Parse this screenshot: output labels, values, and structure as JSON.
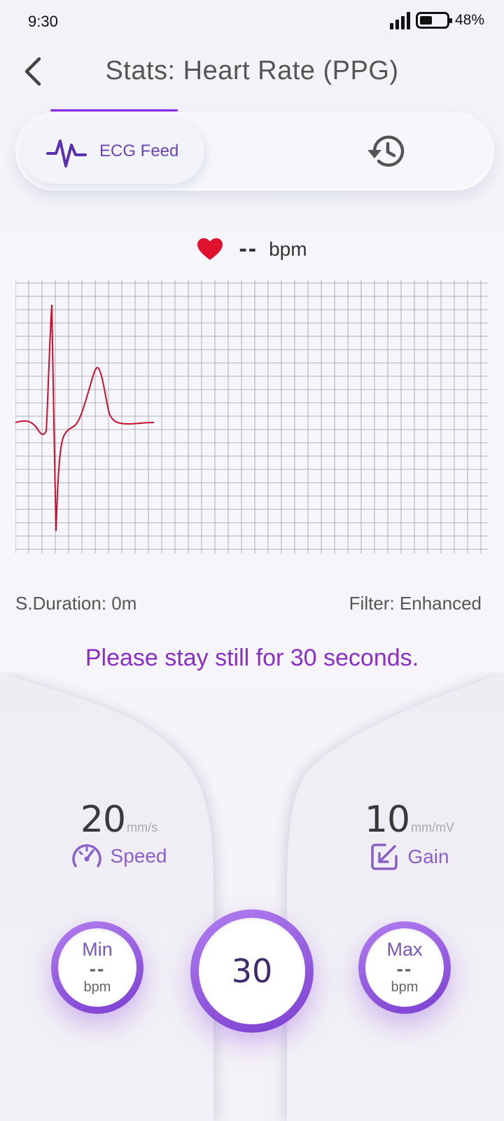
{
  "status": {
    "time": "9:30",
    "battery": "48%",
    "battery_level": 0.48
  },
  "header": {
    "title": "Stats: Heart Rate (PPG)"
  },
  "tabs": {
    "ecg_label": "ECG Feed"
  },
  "heart": {
    "value": "--",
    "unit": "bpm"
  },
  "meta": {
    "duration": "S.Duration: 0m",
    "filter": "Filter: Enhanced"
  },
  "instruction": "Please stay still for 30 seconds.",
  "speed": {
    "value": "20",
    "unit": "mm/s",
    "label": "Speed"
  },
  "gain": {
    "value": "10",
    "unit": "mm/mV",
    "label": "Gain"
  },
  "min": {
    "title": "Min",
    "value": "--",
    "unit": "bpm"
  },
  "max": {
    "title": "Max",
    "value": "--",
    "unit": "bpm"
  },
  "timer": "30",
  "colors": {
    "accent": "#8a2be2",
    "trace": "#c8102e",
    "heart": "#e0102f",
    "label": "#8a5fc7"
  },
  "icons": {
    "back": "chevron-left-icon",
    "ecg": "pulse-icon",
    "history": "history-icon",
    "heart": "heart-icon",
    "speed": "speedometer-icon",
    "gain": "resize-icon"
  }
}
